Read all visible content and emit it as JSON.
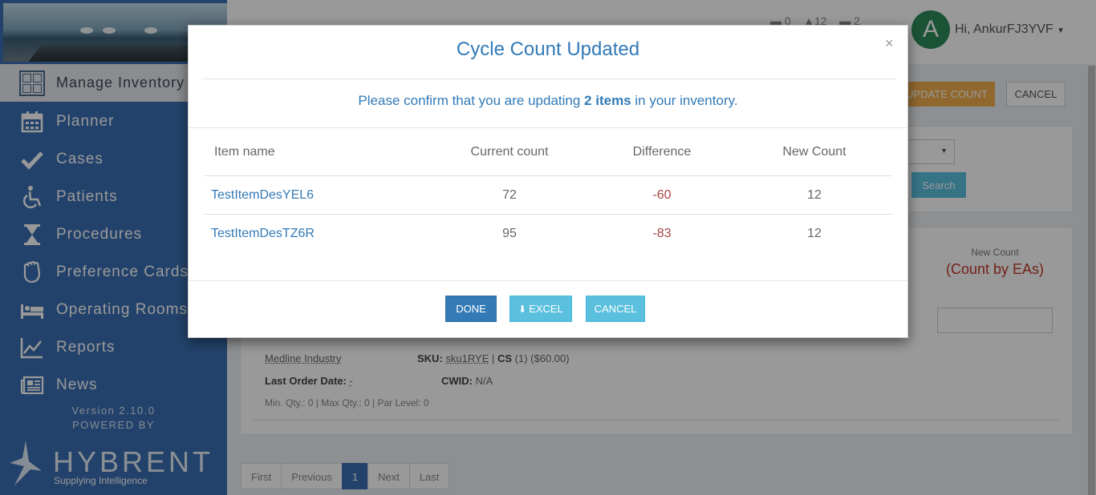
{
  "sidebar": {
    "section_label": "Manage Inventory",
    "items": [
      {
        "label": "Planner",
        "icon": "calendar-icon"
      },
      {
        "label": "Cases",
        "icon": "check-icon"
      },
      {
        "label": "Patients",
        "icon": "wheelchair-icon"
      },
      {
        "label": "Procedures",
        "icon": "hourglass-icon"
      },
      {
        "label": "Preference Cards",
        "icon": "hand-icon"
      },
      {
        "label": "Operating Rooms",
        "icon": "bed-icon"
      },
      {
        "label": "Reports",
        "icon": "line-chart-icon"
      },
      {
        "label": "News",
        "icon": "newspaper-icon"
      }
    ],
    "version": "Version 2.10.0",
    "powered_by": "POWERED BY",
    "brand": "HYBRENT",
    "brand_tagline": "Supplying Intelligence"
  },
  "header": {
    "stat_a": "0",
    "stat_b": "12",
    "stat_c": "2",
    "avatar_letter": "A",
    "greeting": "Hi, AnkurFJ3YVF"
  },
  "background": {
    "update_count": "UPDATE COUNT",
    "cancel": "CANCEL",
    "search": "Search",
    "new_count_label": "New Count",
    "count_by": "(Count by EAs)",
    "vendor": "Medline Industry",
    "sku_label": "SKU:",
    "sku_value": "sku1RYE",
    "cs_label": "CS",
    "cs_value": "(1) ($60.00)",
    "last_order_label": "Last Order Date:",
    "last_order_value": "-",
    "cwid_label": "CWID:",
    "cwid_value": "N/A",
    "qty_line": "Min. Qty.: 0 | Max Qty.: 0 | Par Level: 0",
    "pager": [
      "First",
      "Previous",
      "1",
      "Next",
      "Last"
    ]
  },
  "modal": {
    "title": "Cycle Count Updated",
    "close": "×",
    "confirm_before": "Please confirm that you are updating",
    "confirm_count": "2 items",
    "confirm_after": "in your inventory.",
    "columns": [
      "Item name",
      "Current count",
      "Difference",
      "New Count"
    ],
    "rows": [
      {
        "name": "TestItemDesYEL6",
        "current": "72",
        "difference": "-60",
        "new": "12"
      },
      {
        "name": "TestItemDesTZ6R",
        "current": "95",
        "difference": "-83",
        "new": "12"
      }
    ],
    "buttons": {
      "done": "DONE",
      "excel": "EXCEL",
      "cancel": "CANCEL"
    }
  },
  "colors": {
    "sidebar": "#3b6fb3",
    "primary": "#337ab7",
    "info": "#5bc0de",
    "warning": "#f0ad4e",
    "negative": "#a94442"
  }
}
